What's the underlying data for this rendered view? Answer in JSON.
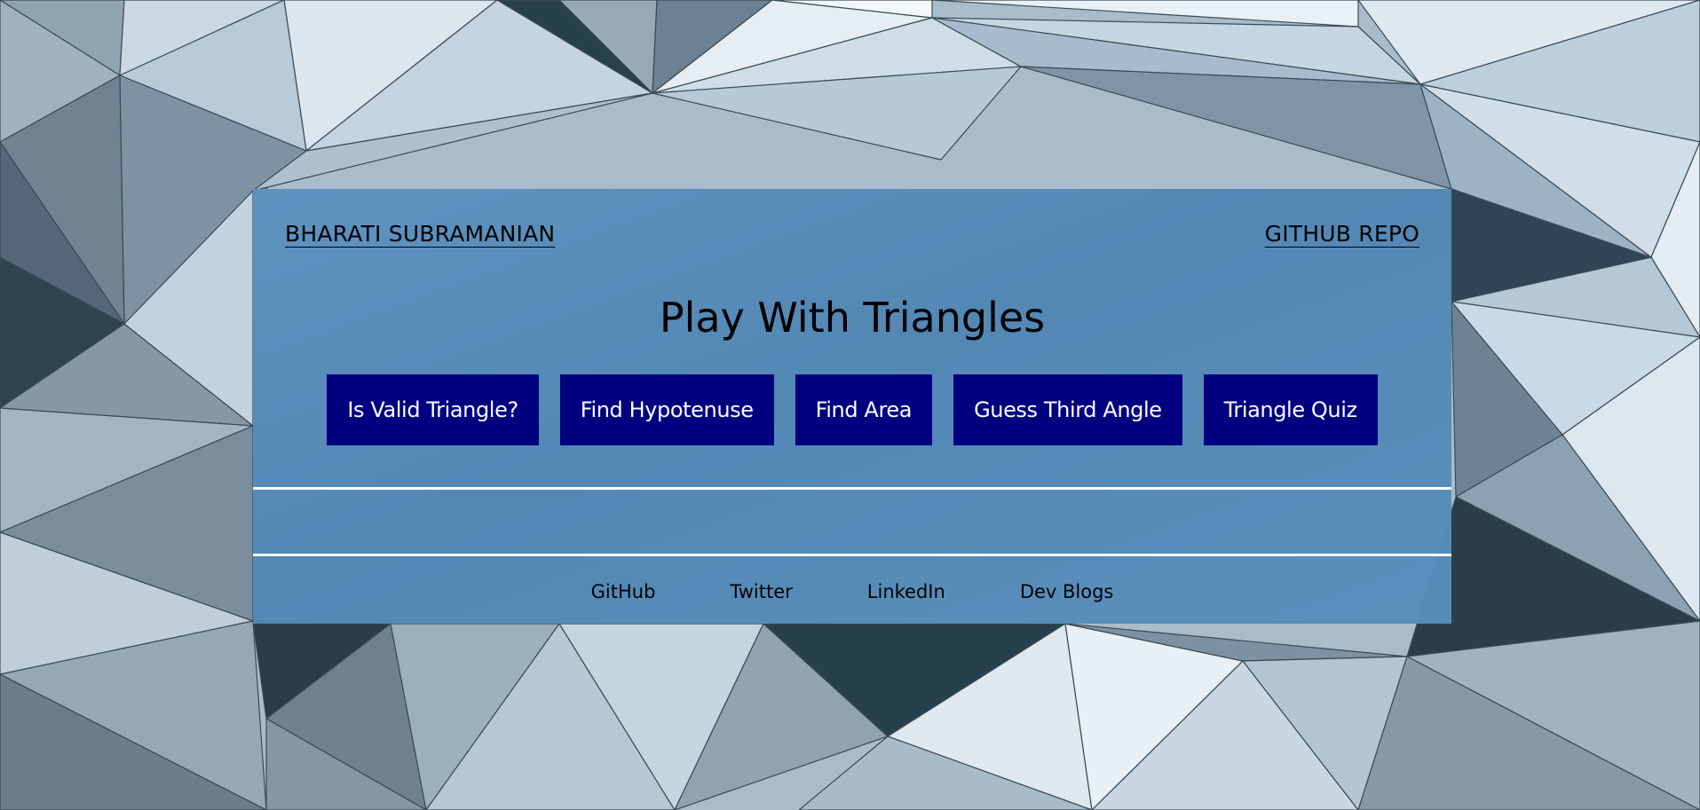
{
  "nav": {
    "brand": "BHARATI SUBRAMANIAN",
    "repo": "GITHUB REPO"
  },
  "title": "Play With Triangles",
  "buttons": [
    "Is Valid Triangle?",
    "Find Hypotenuse",
    "Find Area",
    "Guess Third Angle",
    "Triangle Quiz"
  ],
  "footer": {
    "links": [
      "GitHub",
      "Twitter",
      "LinkedIn",
      "Dev Blogs"
    ]
  },
  "colors": {
    "card_background": "#5a8fbd",
    "button_background": "#000080",
    "button_text": "#ffffff",
    "divider": "#ffffff"
  }
}
